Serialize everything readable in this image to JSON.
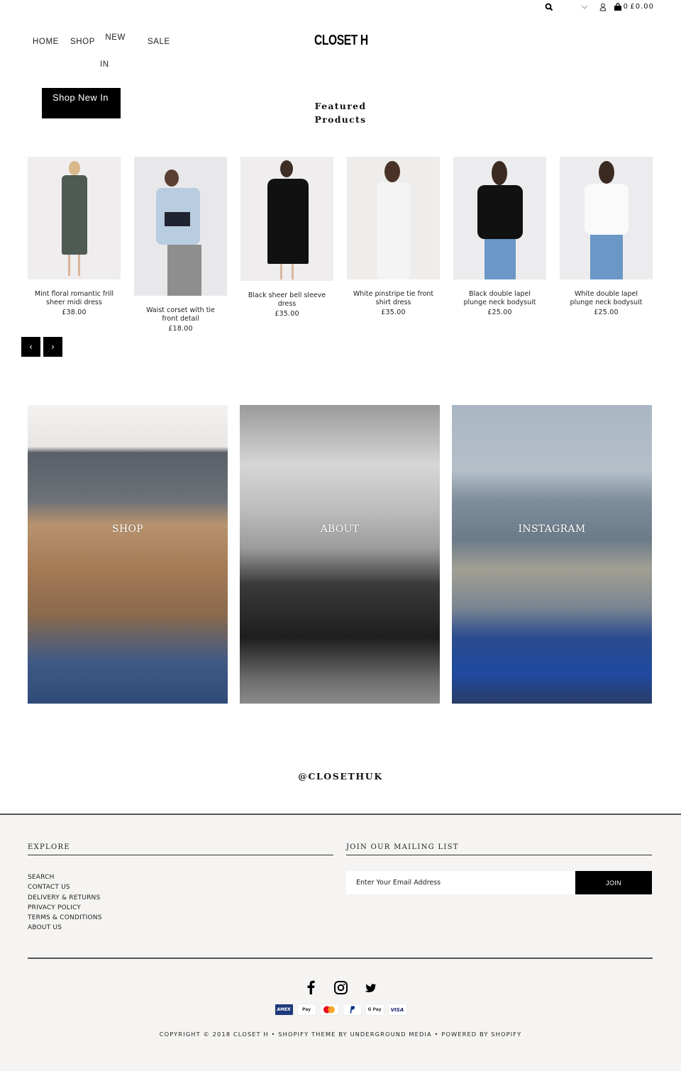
{
  "header": {
    "icons": [
      "search-icon",
      "chevron-down-icon",
      "user-icon",
      "shopping-bag-icon"
    ],
    "cart_count": "0",
    "cart_total": "£0.00",
    "nav": [
      {
        "label": "HOME"
      },
      {
        "label": "SHOP"
      },
      {
        "label_line1": "NEW",
        "label_line2": "IN"
      },
      {
        "label": "SALE"
      }
    ],
    "logo": "CLOSET H"
  },
  "hero": {
    "cta_label": "Shop New In",
    "section_title": "Featured Products"
  },
  "products": [
    {
      "name": "Mint floral romantic frill sheer midi dress",
      "price": "£38.00"
    },
    {
      "name": "Waist corset with tie front detail",
      "price": "£18.00"
    },
    {
      "name": "Black sheer bell sleeve dress",
      "price": "£35.00"
    },
    {
      "name": "White pinstripe tie front shirt dress",
      "price": "£35.00"
    },
    {
      "name": "Black double lapel plunge neck bodysuit",
      "price": "£25.00"
    },
    {
      "name": "White double lapel plunge neck bodysuit",
      "price": "£25.00"
    }
  ],
  "carousel": {
    "prev": "‹",
    "next": "›"
  },
  "panels": [
    {
      "label": "SHOP"
    },
    {
      "label": "ABOUT"
    },
    {
      "label": "INSTAGRAM"
    }
  ],
  "instagram_handle": "@CLOSETHUK",
  "footer": {
    "explore_title": "EXPLORE",
    "links": [
      "SEARCH",
      "CONTACT US",
      "DELIVERY & RETURNS",
      "PRIVACY POLICY",
      "TERMS & CONDITIONS",
      "ABOUT US"
    ],
    "mailing_title": "JOIN OUR MAILING LIST",
    "email_placeholder": "Enter Your Email Address",
    "join_label": "JOIN",
    "social": [
      "facebook-icon",
      "instagram-icon",
      "twitter-icon"
    ],
    "payments": [
      "AMEX",
      "Apple Pay",
      "Mastercard",
      "PayPal",
      "Google Pay",
      "VISA"
    ],
    "payment_labels": {
      "amex": "AMEX",
      "applepay": " Pay",
      "gpay": "G Pay",
      "visa": "VISA"
    },
    "copyright": "COPYRIGHT © 2018 CLOSET H • SHOPIFY THEME BY UNDERGROUND MEDIA •  POWERED BY SHOPIFY"
  }
}
